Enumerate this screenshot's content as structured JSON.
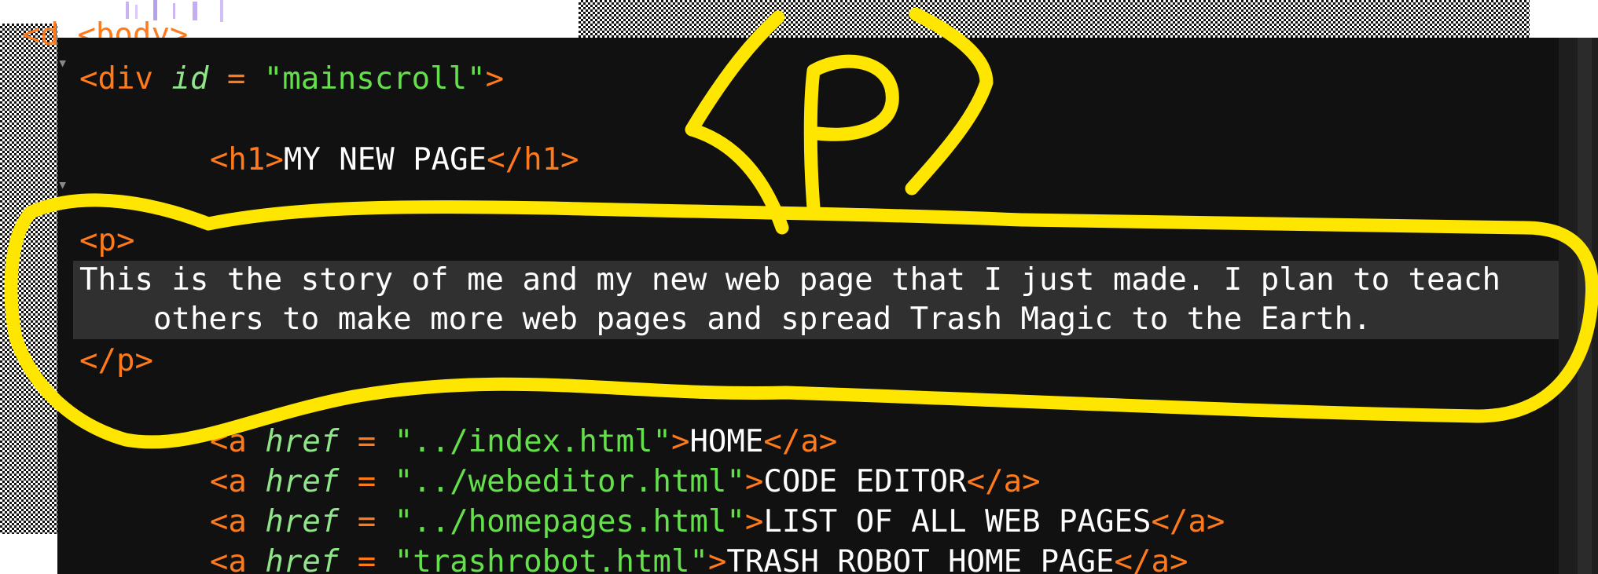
{
  "editor": {
    "partial_top": "<d <body>",
    "lines": [
      {
        "id": "div-open",
        "parts": [
          {
            "c": "tag",
            "t": "<div "
          },
          {
            "c": "attr",
            "t": "id"
          },
          {
            "c": "tag",
            "t": " = "
          },
          {
            "c": "str",
            "t": "\"mainscroll\""
          },
          {
            "c": "tag",
            "t": ">"
          }
        ]
      },
      {
        "id": "h1",
        "parts": [
          {
            "c": "tag",
            "t": "    <h1>"
          },
          {
            "c": "txt",
            "t": "MY NEW PAGE"
          },
          {
            "c": "tag",
            "t": "</h1>"
          }
        ]
      },
      {
        "id": "p-open",
        "parts": [
          {
            "c": "tag",
            "t": "<p>"
          }
        ]
      },
      {
        "id": "p-text-1",
        "parts": [
          {
            "c": "txt",
            "t": "This is the story of me and my new web page that I just made. I plan to teach"
          }
        ]
      },
      {
        "id": "p-text-2",
        "parts": [
          {
            "c": "txt",
            "t": "    others to make more web pages and spread Trash Magic to the Earth."
          }
        ]
      },
      {
        "id": "p-close",
        "parts": [
          {
            "c": "tag",
            "t": "</p>"
          }
        ]
      },
      {
        "id": "link-home",
        "parts": [
          {
            "c": "tag",
            "t": "    <a "
          },
          {
            "c": "attr",
            "t": "href"
          },
          {
            "c": "tag",
            "t": " = "
          },
          {
            "c": "str",
            "t": "\"../index.html\""
          },
          {
            "c": "tag",
            "t": ">"
          },
          {
            "c": "txt",
            "t": "HOME"
          },
          {
            "c": "tag",
            "t": "</a>"
          }
        ]
      },
      {
        "id": "link-editor",
        "parts": [
          {
            "c": "tag",
            "t": "    <a "
          },
          {
            "c": "attr",
            "t": "href"
          },
          {
            "c": "tag",
            "t": " = "
          },
          {
            "c": "str",
            "t": "\"../webeditor.html\""
          },
          {
            "c": "tag",
            "t": ">"
          },
          {
            "c": "txt",
            "t": "CODE EDITOR"
          },
          {
            "c": "tag",
            "t": "</a>"
          }
        ]
      },
      {
        "id": "link-pages",
        "parts": [
          {
            "c": "tag",
            "t": "    <a "
          },
          {
            "c": "attr",
            "t": "href"
          },
          {
            "c": "tag",
            "t": " = "
          },
          {
            "c": "str",
            "t": "\"../homepages.html\""
          },
          {
            "c": "tag",
            "t": ">"
          },
          {
            "c": "txt",
            "t": "LIST OF ALL WEB PAGES"
          },
          {
            "c": "tag",
            "t": "</a>"
          }
        ]
      },
      {
        "id": "link-robot",
        "parts": [
          {
            "c": "tag",
            "t": "    <a "
          },
          {
            "c": "attr",
            "t": "href"
          },
          {
            "c": "tag",
            "t": " = "
          },
          {
            "c": "str",
            "t": "\"trashrobot.html\""
          },
          {
            "c": "tag",
            "t": ">"
          },
          {
            "c": "txt",
            "t": "TRASH ROBOT HOME PAGE"
          },
          {
            "c": "tag",
            "t": "</a>"
          }
        ]
      }
    ]
  },
  "annotation": {
    "handwritten_text": "<P>",
    "color": "#ffe600"
  },
  "colors": {
    "editor_bg": "#111111",
    "tag": "#ff7a1a",
    "attribute": "#90e48a",
    "string": "#63e04a",
    "text": "#ffffff"
  }
}
